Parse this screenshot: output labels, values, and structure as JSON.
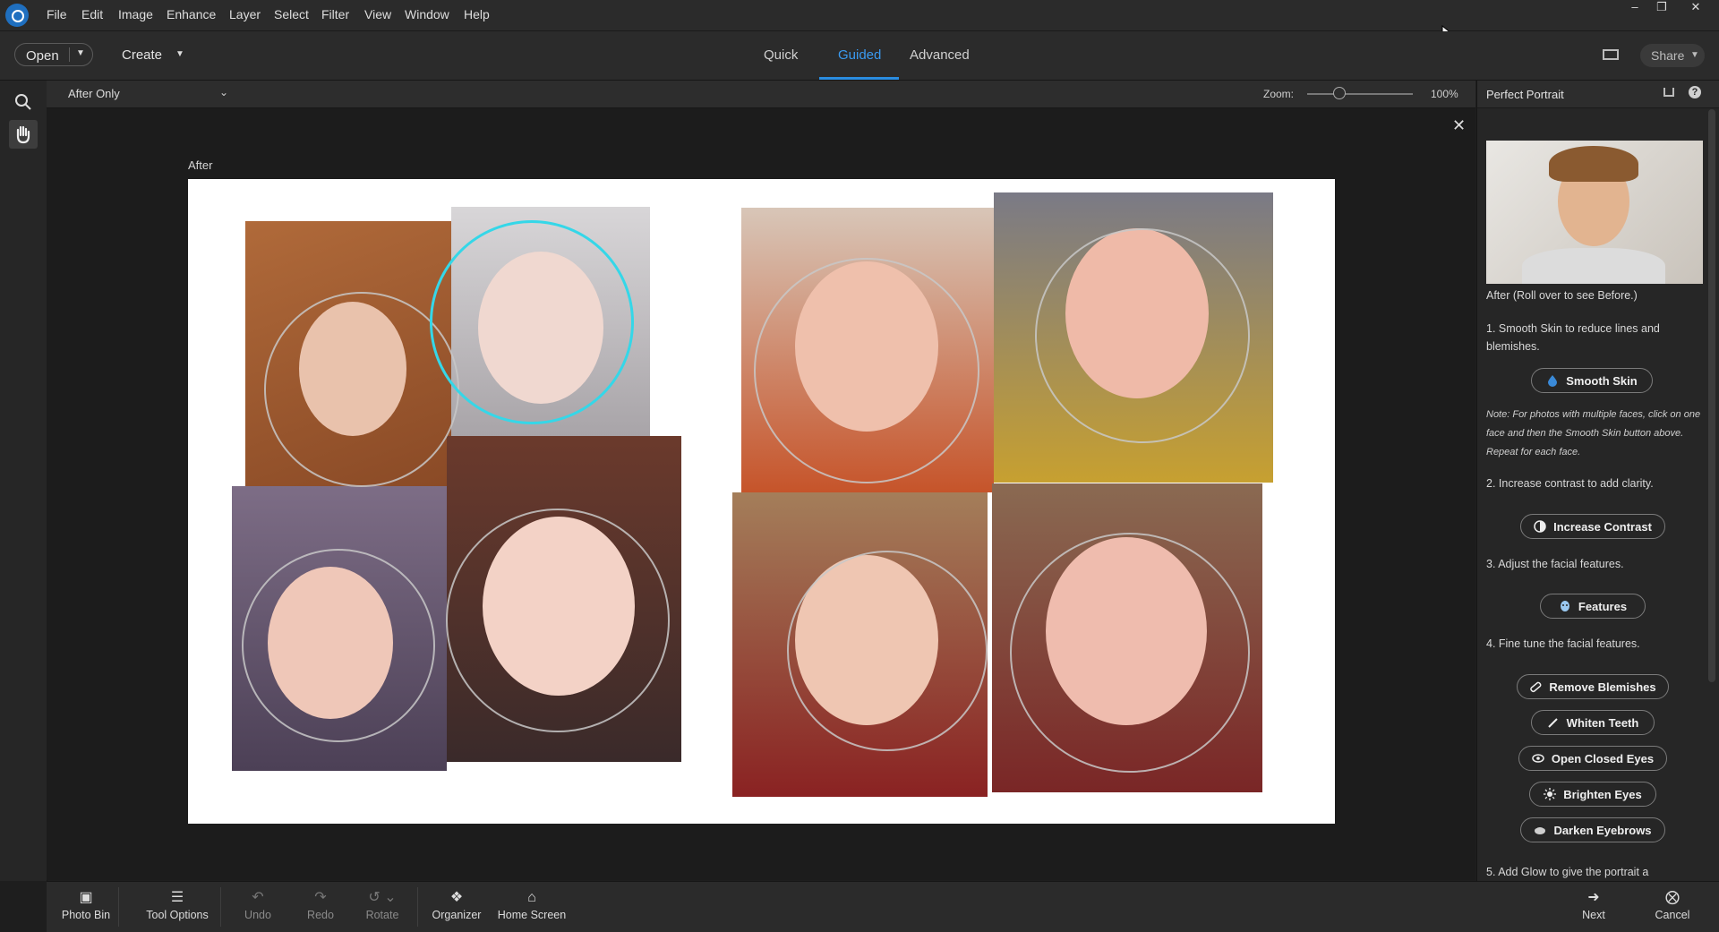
{
  "menu": [
    "File",
    "Edit",
    "Image",
    "Enhance",
    "Layer",
    "Select",
    "Filter",
    "View",
    "Window",
    "Help"
  ],
  "window_controls": {
    "minimize": "–",
    "restore": "❐",
    "close": "✕"
  },
  "toolbar": {
    "open_label": "Open",
    "create_label": "Create",
    "share_label": "Share"
  },
  "mode_tabs": [
    {
      "label": "Quick",
      "active": false
    },
    {
      "label": "Guided",
      "active": true
    },
    {
      "label": "Advanced",
      "active": false
    }
  ],
  "options": {
    "view_select": "After Only",
    "zoom_label": "Zoom:",
    "zoom_value": "100%",
    "zoom_fraction": 0.3
  },
  "canvas": {
    "view_label": "After"
  },
  "panel": {
    "title": "Perfect Portrait",
    "thumb_caption": "After (Roll over to see Before.)",
    "step1": "1. Smooth Skin to reduce lines and blemishes.",
    "smooth_skin": "Smooth Skin",
    "note": "Note: For photos with multiple faces, click on one face and then the Smooth Skin button above. Repeat for each face.",
    "step2": "2. Increase contrast to add clarity.",
    "increase_contrast": "Increase Contrast",
    "step3": "3. Adjust the facial features.",
    "features": "Features",
    "step4": "4. Fine tune the facial features.",
    "remove_blemishes": "Remove Blemishes",
    "whiten_teeth": "Whiten Teeth",
    "open_closed_eyes": "Open Closed Eyes",
    "brighten_eyes": "Brighten Eyes",
    "darken_eyebrows": "Darken Eyebrows",
    "step5": "5. Add Glow to give the portrait a"
  },
  "bottom": {
    "photo_bin": "Photo Bin",
    "tool_options": "Tool Options",
    "undo": "Undo",
    "redo": "Redo",
    "rotate": "Rotate",
    "organizer": "Organizer",
    "home_screen": "Home Screen",
    "next": "Next",
    "cancel": "Cancel"
  },
  "colors": {
    "accent": "#2a8ce0",
    "selected_face_ring": "#35d7e8"
  }
}
